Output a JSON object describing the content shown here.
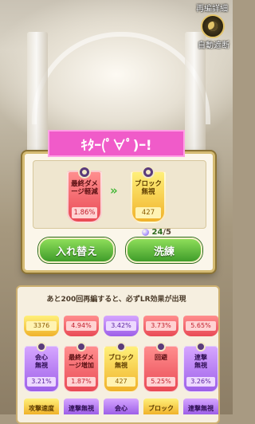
{
  "header": {
    "top_right_label": "再編詳細",
    "auto_stop_label": "自動遮断"
  },
  "banner_text": "ｷﾀｰ(ﾟ∀ﾟ)ｰ!",
  "reforge": {
    "current": {
      "name_line1": "最終ダメ",
      "name_line2": "ージ軽減",
      "value": "1.86%"
    },
    "new": {
      "name_line1": "ブロック",
      "name_line2": "無視",
      "value": "427"
    },
    "arrow": "»",
    "counter_current": "24",
    "counter_max": "/5"
  },
  "buttons": {
    "replace": "入れ替え",
    "refine": "洗練"
  },
  "notice": "あと200回再編すると、必ずLR効果が出現",
  "grid": {
    "row1": [
      {
        "value": "3376",
        "color": "gold"
      },
      {
        "value": "4.94%",
        "color": "red"
      },
      {
        "value": "3.42%",
        "color": "purple"
      },
      {
        "value": "3.73%",
        "color": "red"
      },
      {
        "value": "5.65%",
        "color": "red"
      }
    ],
    "row2": [
      {
        "name_line1": "会心",
        "name_line2": "無視",
        "value": "3.21%",
        "color": "purple"
      },
      {
        "name_line1": "最終ダメ",
        "name_line2": "ージ増加",
        "value": "1.87%",
        "color": "red"
      },
      {
        "name_line1": "ブロック",
        "name_line2": "無視",
        "value": "427",
        "color": "gold"
      },
      {
        "name_line1": "回避",
        "name_line2": "",
        "value": "5.25%",
        "color": "red"
      },
      {
        "name_line1": "連撃",
        "name_line2": "無視",
        "value": "3.26%",
        "color": "purple"
      }
    ],
    "row3": [
      {
        "name_line1": "攻撃速度",
        "color": "gold"
      },
      {
        "name_line1": "連撃無視",
        "color": "purple"
      },
      {
        "name_line1": "会心",
        "color": "purple"
      },
      {
        "name_line1": "ブロック",
        "color": "gold"
      },
      {
        "name_line1": "連撃無視",
        "color": "purple"
      }
    ]
  }
}
